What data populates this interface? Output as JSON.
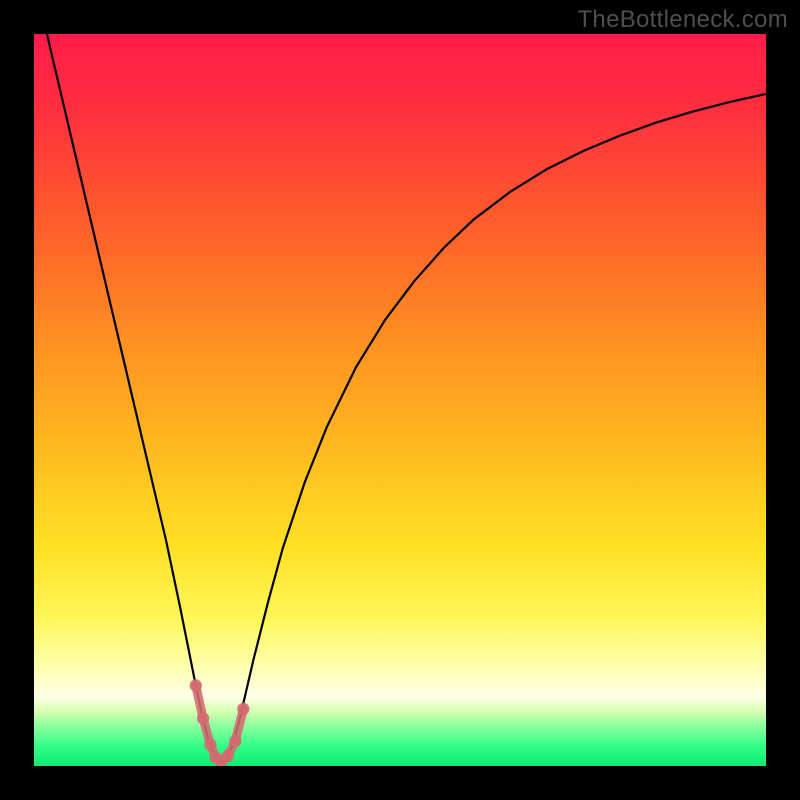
{
  "watermark": "TheBottleneck.com",
  "chart_data": {
    "type": "line",
    "title": "",
    "xlabel": "",
    "ylabel": "",
    "xlim": [
      0,
      100
    ],
    "ylim": [
      0,
      100
    ],
    "gradient": {
      "stops": [
        {
          "offset": 0.0,
          "color": "#ff1c4b"
        },
        {
          "offset": 0.1,
          "color": "#ff2e3f"
        },
        {
          "offset": 0.25,
          "color": "#ff5a2b"
        },
        {
          "offset": 0.4,
          "color": "#ff8a22"
        },
        {
          "offset": 0.55,
          "color": "#ffb51f"
        },
        {
          "offset": 0.7,
          "color": "#ffe024"
        },
        {
          "offset": 0.8,
          "color": "#fff75a"
        },
        {
          "offset": 0.86,
          "color": "#ffffa8"
        },
        {
          "offset": 0.905,
          "color": "#ffffe6"
        },
        {
          "offset": 0.925,
          "color": "#d7ffb2"
        },
        {
          "offset": 0.95,
          "color": "#7dff9a"
        },
        {
          "offset": 0.975,
          "color": "#2dfd86"
        },
        {
          "offset": 1.0,
          "color": "#16e873"
        }
      ]
    },
    "series": [
      {
        "name": "bottleneck-curve",
        "x": [
          0.0,
          2.0,
          4.0,
          6.0,
          8.0,
          10.0,
          12.0,
          14.0,
          16.0,
          18.0,
          20.0,
          21.0,
          22.0,
          23.0,
          24.0,
          24.8,
          25.6,
          26.4,
          27.2,
          28.0,
          30.0,
          32.0,
          34.0,
          37.0,
          40.0,
          44.0,
          48.0,
          52.0,
          56.0,
          60.0,
          65.0,
          70.0,
          75.0,
          80.0,
          85.0,
          90.0,
          95.0,
          100.0
        ],
        "y": [
          108.0,
          99.0,
          90.5,
          82.0,
          73.5,
          65.0,
          56.5,
          48.0,
          39.5,
          31.0,
          21.5,
          16.5,
          11.5,
          6.8,
          3.0,
          1.2,
          0.6,
          1.2,
          3.0,
          6.0,
          14.6,
          22.5,
          29.8,
          38.8,
          46.3,
          54.5,
          61.0,
          66.3,
          70.8,
          74.6,
          78.4,
          81.5,
          84.0,
          86.1,
          87.9,
          89.4,
          90.7,
          91.8
        ]
      }
    ],
    "markers": {
      "name": "highlight-segment",
      "color": "#d46a6f",
      "x": [
        22.1,
        23.1,
        24.1,
        24.8,
        25.6,
        26.5,
        27.5,
        28.6
      ],
      "y": [
        11.0,
        6.5,
        2.9,
        1.2,
        0.6,
        1.4,
        3.4,
        7.8
      ]
    }
  }
}
